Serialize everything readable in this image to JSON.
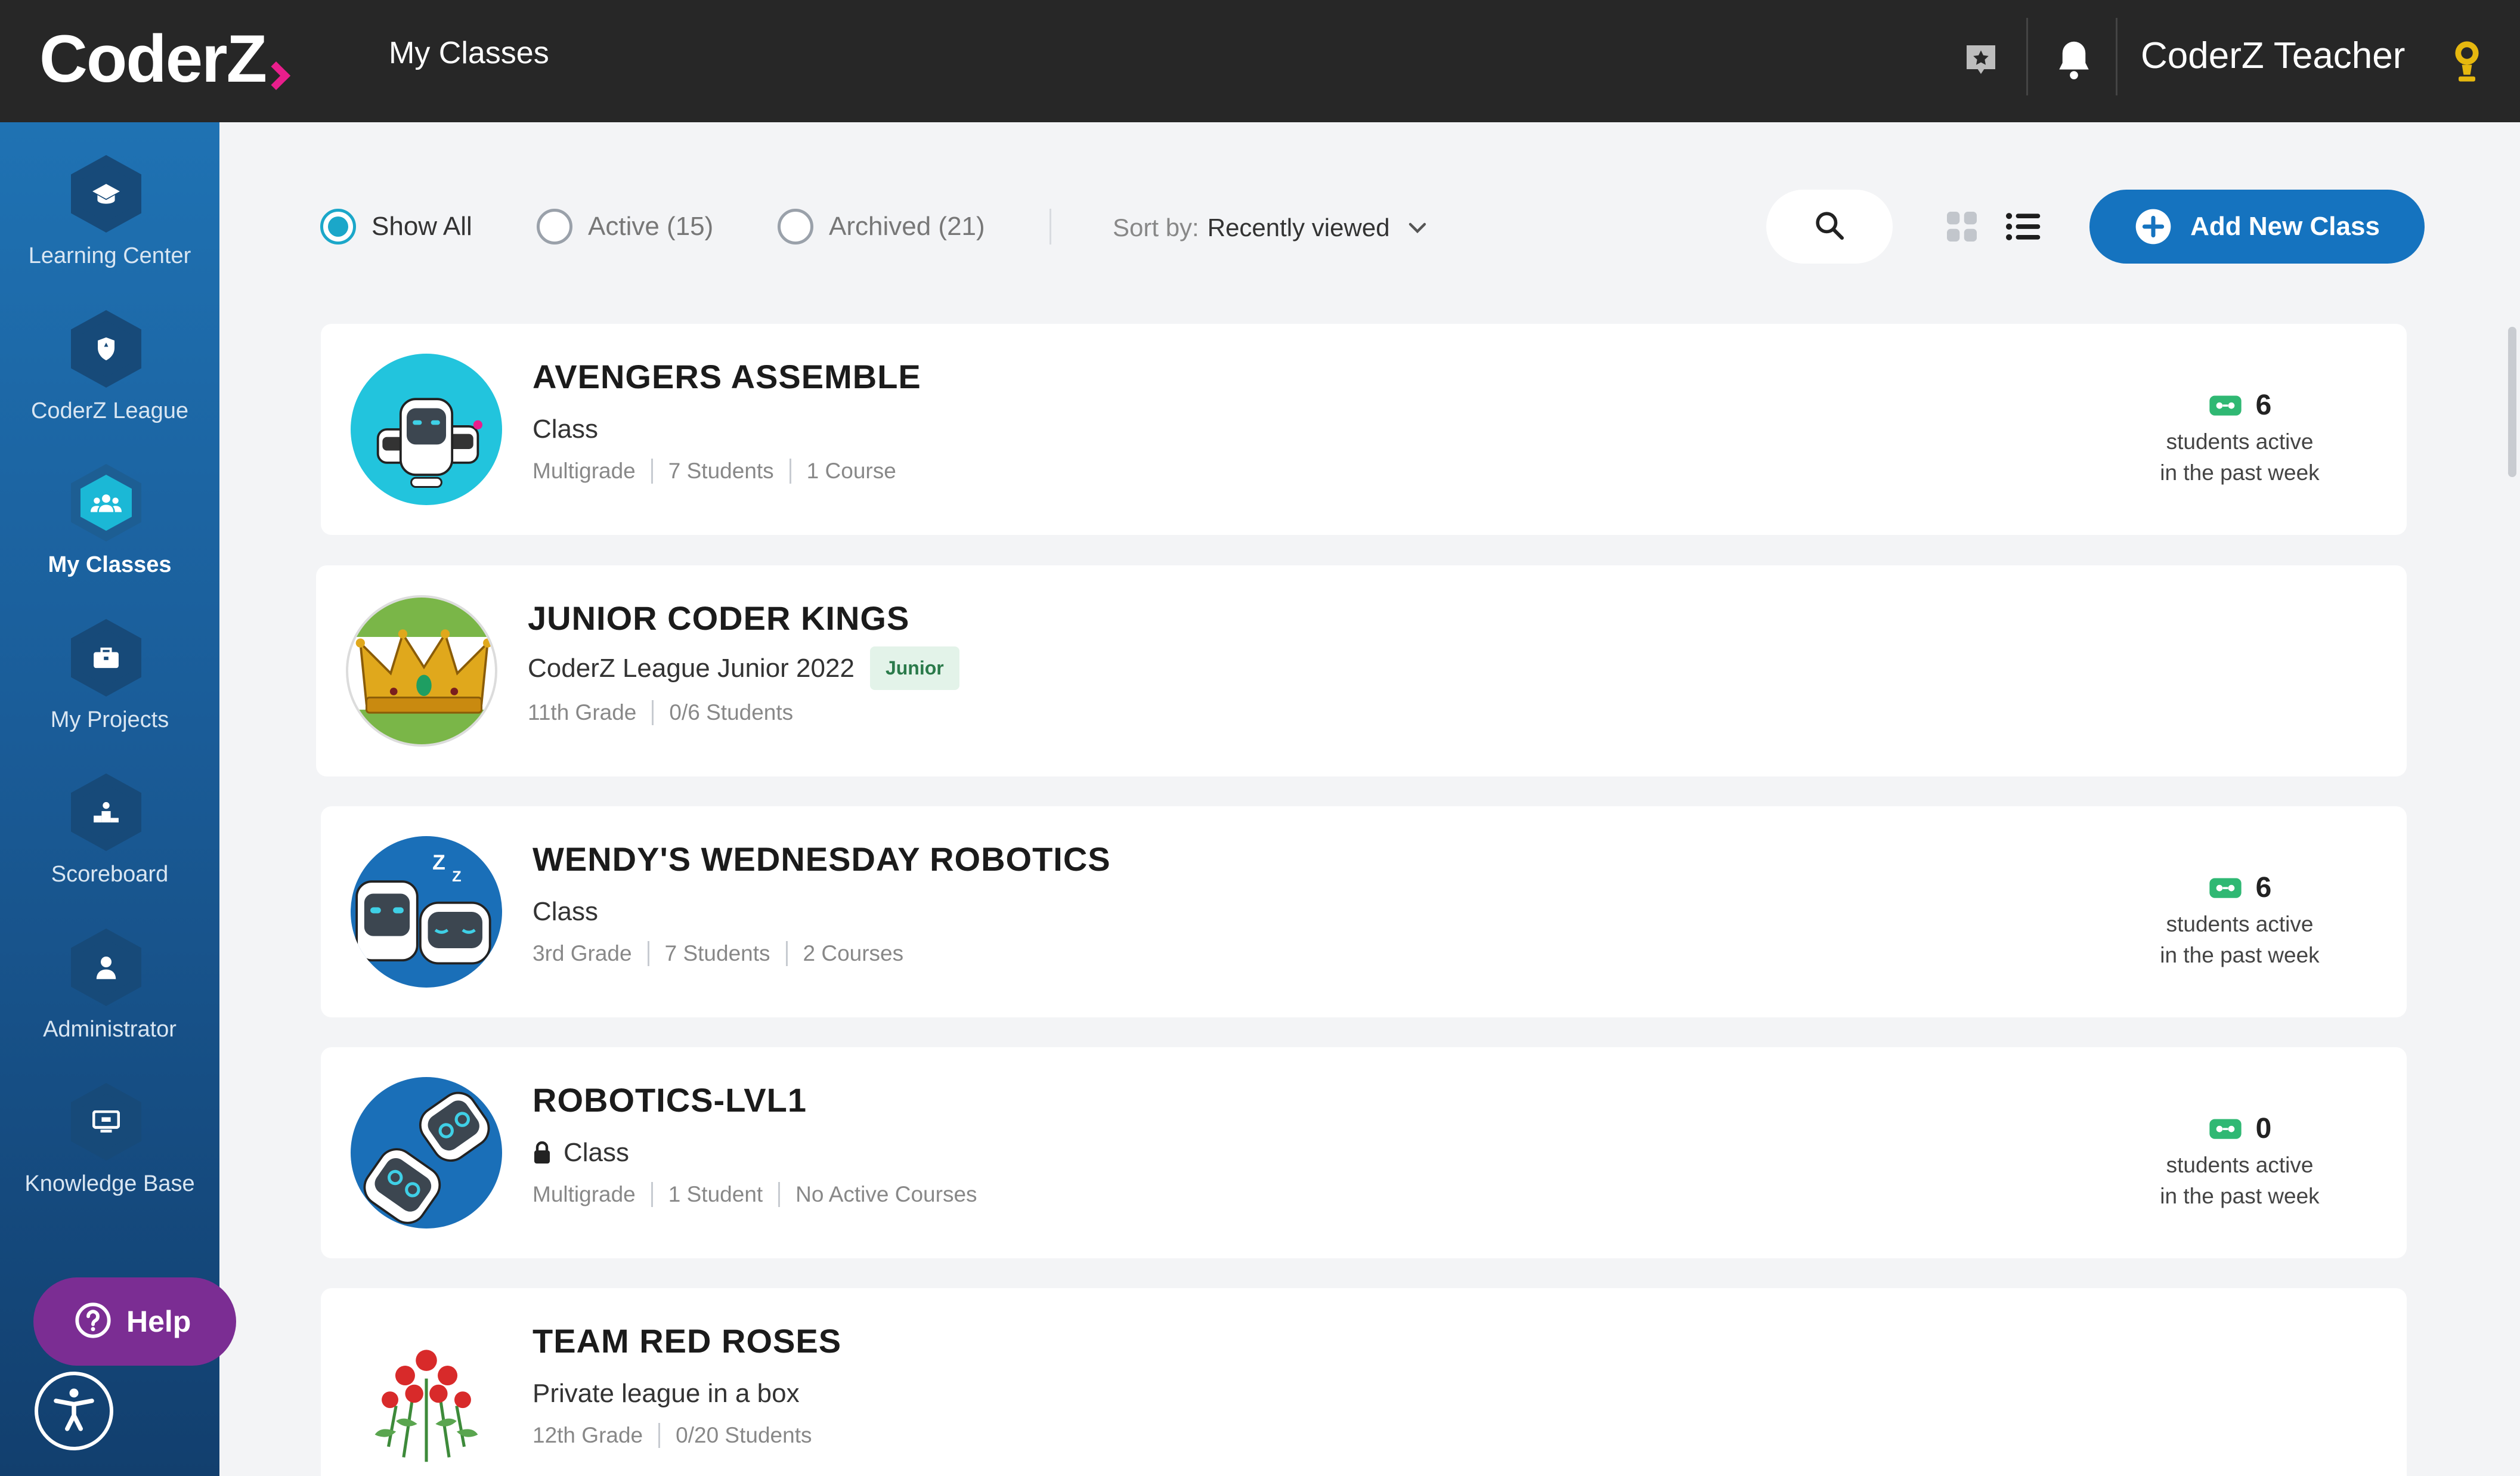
{
  "app": {
    "logo_text": "CoderZ"
  },
  "header": {
    "page_title": "My Classes",
    "user_name": "CoderZ Teacher"
  },
  "sidebar": {
    "items": [
      {
        "label": "Learning Center",
        "icon": "graduation-cap-icon",
        "active": false
      },
      {
        "label": "CoderZ League",
        "icon": "shield-icon",
        "active": false
      },
      {
        "label": "My Classes",
        "icon": "group-icon",
        "active": true
      },
      {
        "label": "My Projects",
        "icon": "briefcase-icon",
        "active": false
      },
      {
        "label": "Scoreboard",
        "icon": "podium-icon",
        "active": false
      },
      {
        "label": "Administrator",
        "icon": "person-icon",
        "active": false
      },
      {
        "label": "Knowledge Base",
        "icon": "monitor-icon",
        "active": false
      }
    ],
    "help_label": "Help"
  },
  "toolbar": {
    "filters": [
      {
        "label": "Show All",
        "checked": true
      },
      {
        "label": "Active (15)",
        "checked": false
      },
      {
        "label": "Archived (21)",
        "checked": false
      }
    ],
    "sort_label": "Sort by:",
    "sort_value": "Recently viewed",
    "view_mode": "list",
    "add_label": "Add New Class"
  },
  "classes": [
    {
      "name": "AVENGERS ASSEMBLE",
      "type": "Class",
      "locked": false,
      "badge": "",
      "meta": [
        "Multigrade",
        "7 Students",
        "1 Course"
      ],
      "active_count": "6",
      "active_text_1": "students active",
      "active_text_2": "in the past week"
    },
    {
      "name": "JUNIOR CODER KINGS",
      "type": "CoderZ League Junior 2022",
      "locked": false,
      "badge": "Junior",
      "meta": [
        "11th Grade",
        "0/6 Students"
      ]
    },
    {
      "name": "WENDY'S WEDNESDAY ROBOTICS",
      "type": "Class",
      "locked": false,
      "badge": "",
      "meta": [
        "3rd Grade",
        "7 Students",
        "2 Courses"
      ],
      "active_count": "6",
      "active_text_1": "students active",
      "active_text_2": "in the past week"
    },
    {
      "name": "ROBOTICS-LVL1",
      "type": "Class",
      "locked": true,
      "badge": "",
      "meta": [
        "Multigrade",
        "1 Student",
        "No Active Courses"
      ],
      "active_count": "0",
      "active_text_1": "students active",
      "active_text_2": "in the past week"
    },
    {
      "name": "TEAM RED ROSES",
      "type": "Private league in a box",
      "locked": false,
      "badge": "",
      "meta": [
        "12th Grade",
        "0/20 Students"
      ]
    }
  ],
  "colors": {
    "topbar": "#272727",
    "sidebar": "#1a5c98",
    "accent": "#1ba7c9",
    "primary_button": "#1573bf",
    "help": "#7b2d93",
    "badge_bg": "#e3f3e9",
    "badge_text": "#2a7a4a"
  }
}
